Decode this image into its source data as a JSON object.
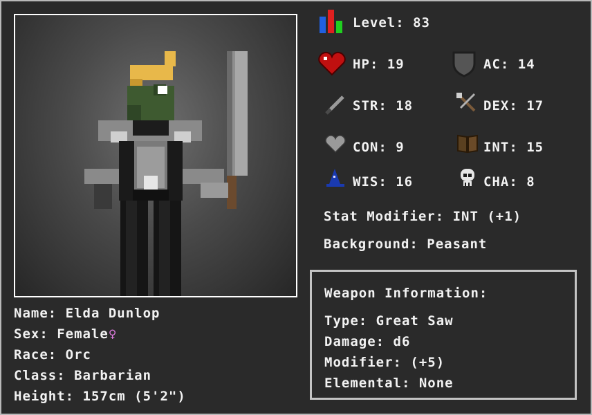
{
  "character": {
    "name": "Name: Elda Dunlop",
    "sex": "Sex: Female",
    "sex_symbol": "♀",
    "race": "Race: Orc",
    "class": "Class: Barbarian",
    "height": "Height: 157cm (5'2\")"
  },
  "stats": {
    "level": "Level: 83",
    "hp": "HP: 19",
    "ac": "AC: 14",
    "str": "STR: 18",
    "dex": "DEX: 17",
    "con": "CON: 9",
    "int": "INT: 15",
    "wis": "WIS: 16",
    "cha": "CHA: 8",
    "modifier": "Stat Modifier: INT (+1)",
    "background": "Background: Peasant"
  },
  "weapon": {
    "heading": "Weapon Information:",
    "type": "Type: Great Saw",
    "damage": "Damage: d6",
    "modifier": "Modifier: (+5)",
    "elemental": "Elemental: None"
  },
  "icons": {
    "level": "level-bars-icon",
    "hp": "heart-icon",
    "ac": "shield-icon",
    "str": "sword-icon",
    "dex": "crossbow-icon",
    "con": "grey-heart-icon",
    "int": "book-icon",
    "wis": "wizard-hat-icon",
    "cha": "skull-icon"
  },
  "colors": {
    "sex_symbol": "#e07ce0",
    "hair": "#e8b84a",
    "skin": "#3e5a30"
  }
}
